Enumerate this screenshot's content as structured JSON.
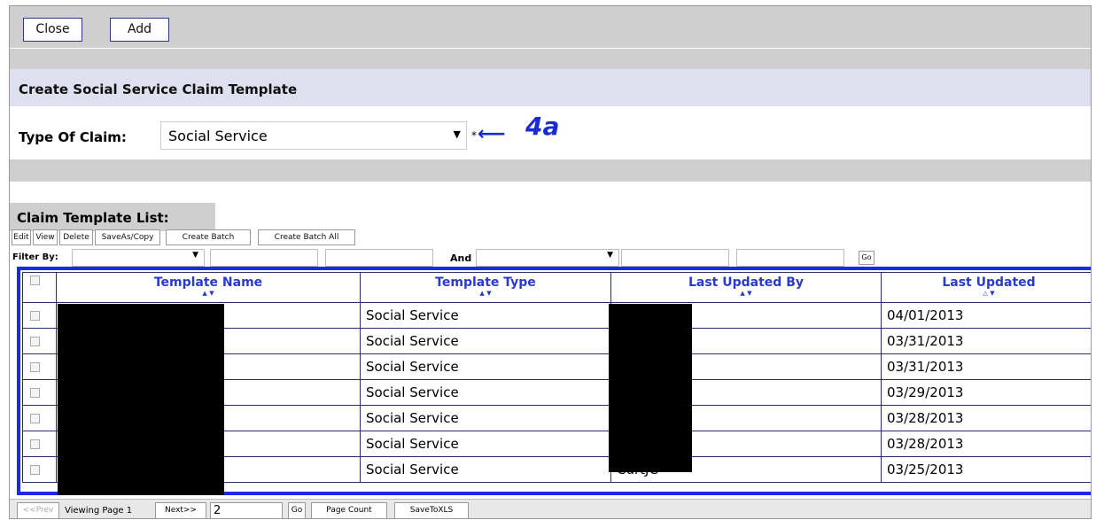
{
  "toolbar": {
    "close_label": "Close",
    "add_label": "Add"
  },
  "page_title": "Create Social Service Claim Template",
  "claim": {
    "label": "Type Of Claim:",
    "value": "Social Service",
    "required_mark": "*",
    "annotation": "4a"
  },
  "list": {
    "title": "Claim Template List:",
    "actions": [
      "Edit",
      "View",
      "Delete",
      "SaveAs/Copy",
      "Create Batch",
      "Create Batch All"
    ],
    "filter_label": "Filter By:",
    "and_label": "And",
    "go_label": "Go"
  },
  "table": {
    "columns": [
      "Template Name",
      "Template Type",
      "Last Updated By",
      "Last Updated"
    ],
    "rows": [
      {
        "type": "Social Service",
        "by": "",
        "date": "04/01/2013"
      },
      {
        "type": "Social Service",
        "by": "",
        "date": "03/31/2013"
      },
      {
        "type": "Social Service",
        "by": "",
        "date": "03/31/2013"
      },
      {
        "type": "Social Service",
        "by": "",
        "date": "03/29/2013"
      },
      {
        "type": "Social Service",
        "by": "",
        "date": "03/28/2013"
      },
      {
        "type": "Social Service",
        "by": "",
        "date": "03/28/2013"
      },
      {
        "type": "Social Service",
        "by": "CurtJC",
        "date": "03/25/2013"
      }
    ]
  },
  "pager": {
    "prev_label": "<<Prev",
    "viewing_label": "Viewing Page 1",
    "next_label": "Next>>",
    "page_input": "2",
    "go_label": "Go",
    "page_count_label": "Page Count",
    "save_label": "SaveToXLS"
  }
}
